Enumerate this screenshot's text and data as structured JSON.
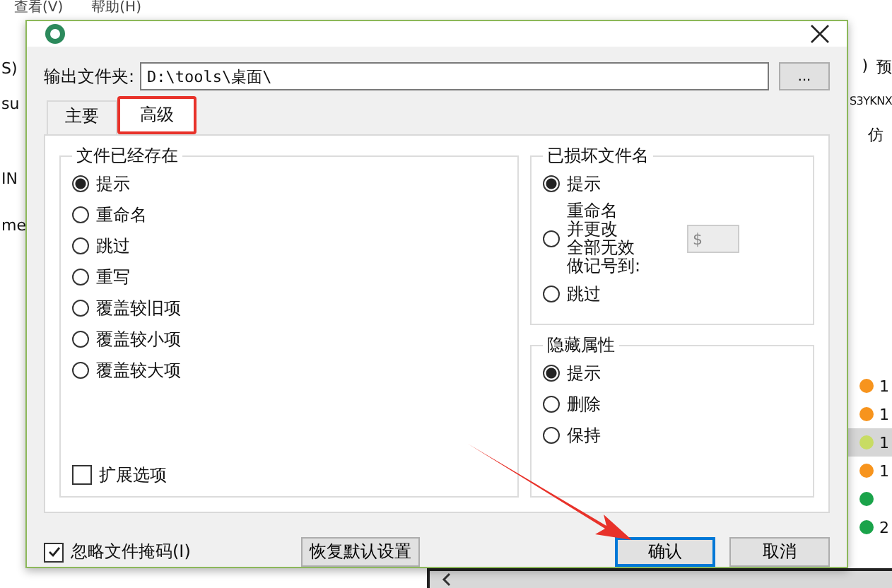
{
  "background": {
    "menu": [
      "查看(V)",
      "帮助(H)"
    ],
    "left_texts": [
      "S)",
      "su",
      "IN",
      "me"
    ],
    "right_top": [
      ")",
      "预"
    ],
    "right_texts": [
      "S3YKNX",
      "仿"
    ],
    "status_rows": [
      {
        "color": "#f7941d",
        "text": "1",
        "selected": false
      },
      {
        "color": "#f7941d",
        "text": "1",
        "selected": false
      },
      {
        "color": "#c8dc64",
        "text": "1",
        "selected": true
      },
      {
        "color": "#f7941d",
        "text": "1",
        "selected": false
      },
      {
        "color": "#1aa34a",
        "selected": false
      },
      {
        "color": "#1aa34a",
        "text": "2",
        "selected": false
      }
    ]
  },
  "dialog": {
    "output_folder": {
      "label": "输出文件夹:",
      "value": "D:\\tools\\桌面\\"
    },
    "browse_button": "...",
    "tabs": [
      {
        "label": "主要",
        "selected": false
      },
      {
        "label": "高级",
        "selected": true
      }
    ],
    "groups": [
      {
        "title": "文件已经存在",
        "options": [
          {
            "kind": "radio",
            "label": "提示",
            "selected": true
          },
          {
            "kind": "radio",
            "label": "重命名",
            "selected": false
          },
          {
            "kind": "radio",
            "label": "跳过",
            "selected": false
          },
          {
            "kind": "radio",
            "label": "重写",
            "selected": false
          },
          {
            "kind": "radio",
            "label": "覆盖较旧项",
            "selected": false
          },
          {
            "kind": "radio",
            "label": "覆盖较小项",
            "selected": false
          },
          {
            "kind": "radio",
            "label": "覆盖较大项",
            "selected": false
          }
        ],
        "checkbox": {
          "label": "扩展选项",
          "checked": false
        }
      },
      {
        "title": "已损坏文件名",
        "options": [
          {
            "kind": "radio",
            "label": "提示",
            "selected": true
          },
          {
            "kind": "radio_field",
            "lines": [
              "重命名",
              "并更改",
              "全部无效",
              "做记号到:"
            ],
            "selected": false,
            "field": {
              "value": "$",
              "disabled": true
            }
          },
          {
            "kind": "radio",
            "label": "跳过",
            "selected": false
          }
        ]
      },
      {
        "title": "隐藏属性",
        "options": [
          {
            "kind": "radio",
            "label": "提示",
            "selected": true
          },
          {
            "kind": "radio",
            "label": "删除",
            "selected": false
          },
          {
            "kind": "radio",
            "label": "保持",
            "selected": false
          }
        ]
      }
    ],
    "ignore_mask": {
      "label": "忽略文件掩码(I)",
      "checked": true
    },
    "reset_button": "恢复默认设置",
    "buttons": [
      {
        "label": "确认",
        "default": true
      },
      {
        "label": "取消",
        "default": false
      }
    ]
  }
}
